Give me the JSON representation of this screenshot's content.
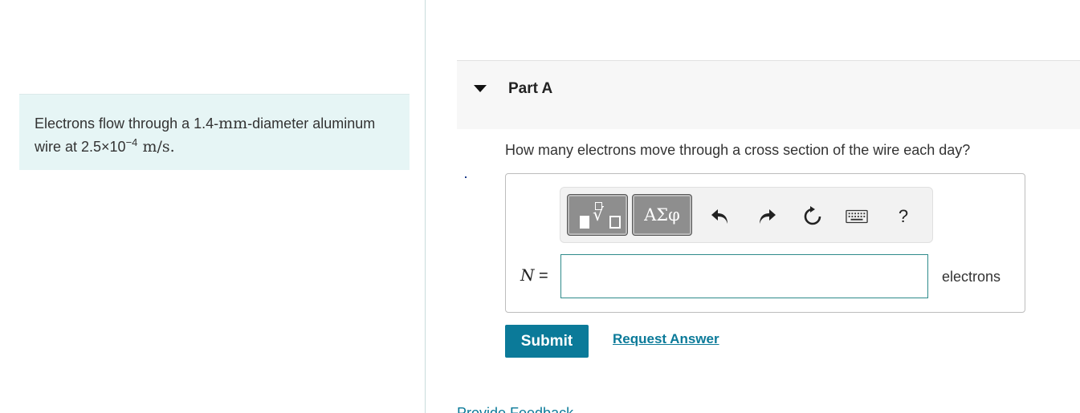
{
  "problem": {
    "text_start": "Electrons flow through a 1.4-",
    "unit_mm": "mm",
    "text_mid": "-diameter aluminum wire at 2.5×10",
    "exponent": "−4",
    "unit_speed": " m/s",
    "text_end": "."
  },
  "part": {
    "title": "Part A",
    "question": "How many electrons move through a cross section of the wire each day?"
  },
  "toolbar": {
    "greek_label": "ΑΣφ",
    "help_label": "?"
  },
  "answer": {
    "variable": "N",
    "equals": " =",
    "value": "",
    "units": "electrons"
  },
  "actions": {
    "submit_label": "Submit",
    "request_label": "Request Answer"
  },
  "footer": {
    "partial_text": "Provide Feedback"
  }
}
